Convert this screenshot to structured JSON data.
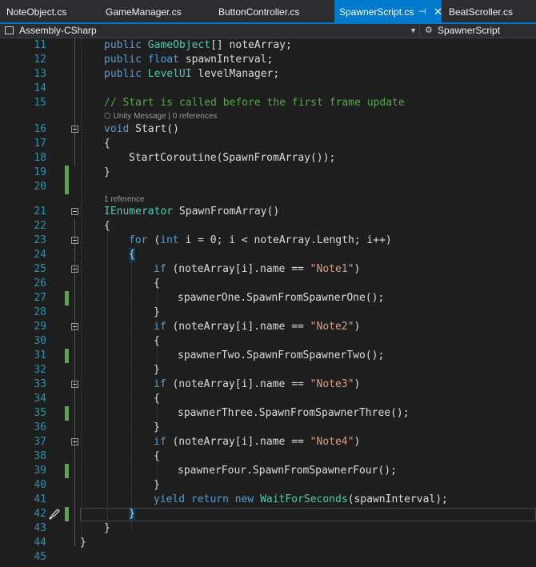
{
  "tabs": [
    {
      "label": "NoteObject.cs",
      "active": false
    },
    {
      "label": "GameManager.cs",
      "active": false
    },
    {
      "label": "ButtonController.cs",
      "active": false
    },
    {
      "label": "SpawnerScript.cs",
      "active": true,
      "pin_icon": "pin-icon",
      "close_icon": "close-icon"
    },
    {
      "label": "BeatScroller.cs",
      "active": false
    }
  ],
  "navbar": {
    "project": "Assembly-CSharp",
    "project_icon": "project-icon",
    "dropdown_icon": "chevron-down-icon",
    "class_icon": "class-icon",
    "class": "SpawnerScript"
  },
  "codelens": {
    "unity_message": "Unity Message | 0 references",
    "unity_icon": "unity-icon",
    "references": "1 reference"
  },
  "line_numbers": [
    "11",
    "12",
    "13",
    "14",
    "15",
    "16",
    "17",
    "18",
    "19",
    "20",
    "21",
    "22",
    "23",
    "24",
    "25",
    "26",
    "27",
    "28",
    "29",
    "30",
    "31",
    "32",
    "33",
    "34",
    "35",
    "36",
    "37",
    "38",
    "39",
    "40",
    "41",
    "42",
    "43",
    "44",
    "45"
  ],
  "code": {
    "l11": {
      "kw": "public",
      "type": "GameObject",
      "rest": "[] noteArray;"
    },
    "l12": {
      "kw1": "public",
      "kw2": "float",
      "rest": "spawnInterval;"
    },
    "l13": {
      "kw": "public",
      "type": "LevelUI",
      "rest": "levelManager;"
    },
    "l15": "// Start is called before the first frame update",
    "l16": {
      "kw": "void",
      "rest": "Start()"
    },
    "l17": "{",
    "l18": "StartCoroutine(SpawnFromArray());",
    "l19": "}",
    "l21": {
      "type": "IEnumerator",
      "rest": "SpawnFromArray()"
    },
    "l22": "{",
    "l23": {
      "kw1": "for",
      "p1": "(",
      "kw2": "int",
      "rest": "i = 0; i < noteArray.Length; i++)"
    },
    "l24": "{",
    "l25": {
      "kw": "if",
      "rest": "(noteArray[i].name == ",
      "str": "\"Note1\"",
      "end": ")"
    },
    "l26": "{",
    "l27": "spawnerOne.SpawnFromSpawnerOne();",
    "l28": "}",
    "l29": {
      "kw": "if",
      "rest": "(noteArray[i].name == ",
      "str": "\"Note2\"",
      "end": ")"
    },
    "l30": "{",
    "l31": "spawnerTwo.SpawnFromSpawnerTwo();",
    "l32": "}",
    "l33": {
      "kw": "if",
      "rest": "(noteArray[i].name == ",
      "str": "\"Note3\"",
      "end": ")"
    },
    "l34": "{",
    "l35": "spawnerThree.SpawnFromSpawnerThree();",
    "l36": "}",
    "l37": {
      "kw": "if",
      "rest": "(noteArray[i].name == ",
      "str": "\"Note4\"",
      "end": ")"
    },
    "l38": "{",
    "l39": "spawnerFour.SpawnFromSpawnerFour();",
    "l40": "}",
    "l41": {
      "kw1": "yield",
      "kw2": "return",
      "kw3": "new",
      "type": "WaitForSeconds",
      "rest": "(spawnInterval);"
    },
    "l42": "}",
    "l43": "}",
    "l44": "}"
  },
  "colors": {
    "keyword": "#569cd6",
    "type": "#4ec9b0",
    "comment": "#57a64a",
    "string": "#d69d85",
    "line_number": "#2b91af",
    "change_marker": "#57a64a",
    "accent": "#007acc"
  },
  "gutter_icon": "paintbrush-icon"
}
